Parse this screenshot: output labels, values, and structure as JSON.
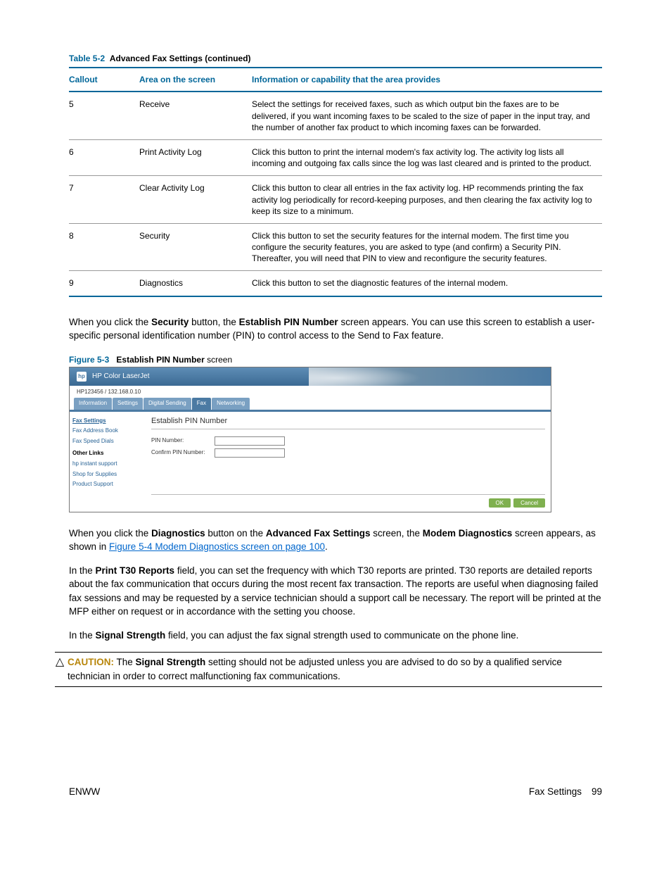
{
  "table": {
    "caption_label": "Table 5-2",
    "caption_text": "Advanced Fax Settings (continued)",
    "headers": {
      "c1": "Callout",
      "c2": "Area on the screen",
      "c3": "Information or capability that the area provides"
    },
    "rows": [
      {
        "c1": "5",
        "c2": "Receive",
        "c3": "Select the settings for received faxes, such as which output bin the faxes are to be delivered, if you want incoming faxes to be scaled to the size of paper in the input tray, and the number of another fax product to which incoming faxes can be forwarded."
      },
      {
        "c1": "6",
        "c2": "Print Activity Log",
        "c3": "Click this button to print the internal modem's fax activity log. The activity log lists all incoming and outgoing fax calls since the log was last cleared and is printed to the product."
      },
      {
        "c1": "7",
        "c2": "Clear Activity Log",
        "c3": "Click this button to clear all entries in the fax activity log. HP recommends printing the fax activity log periodically for record-keeping purposes, and then clearing the fax activity log to keep its size to a minimum."
      },
      {
        "c1": "8",
        "c2": "Security",
        "c3": "Click this button to set the security features for the internal modem. The first time you configure the security features, you are asked to type (and confirm) a Security PIN. Thereafter, you will need that PIN to view and reconfigure the security features."
      },
      {
        "c1": "9",
        "c2": "Diagnostics",
        "c3": "Click this button to set the diagnostic features of the internal modem."
      }
    ]
  },
  "para1_a": "When you click the ",
  "para1_b": "Security",
  "para1_c": " button, the ",
  "para1_d": "Establish PIN Number",
  "para1_e": " screen appears. You can use this screen to establish a user-specific personal identification number (PIN) to control access to the Send to Fax feature.",
  "figure": {
    "label": "Figure 5-3",
    "bold": "Establish PIN Number",
    "rest": " screen"
  },
  "ss": {
    "logo": "hp",
    "title": "HP Color LaserJet",
    "addr": "HP123456 / 132.168.0.10",
    "tabs": [
      "Information",
      "Settings",
      "Digital Sending",
      "Fax",
      "Networking"
    ],
    "side_links": [
      "Fax Settings",
      "Fax Address Book",
      "Fax Speed Dials"
    ],
    "other_links_hdr": "Other Links",
    "other_links": [
      "hp instant support",
      "Shop for Supplies",
      "Product Support"
    ],
    "heading": "Establish PIN Number",
    "field1": "PIN Number:",
    "field2": "Confirm PIN Number:",
    "ok": "OK",
    "cancel": "Cancel"
  },
  "para2_a": "When you click the ",
  "para2_b": "Diagnostics",
  "para2_c": " button on the ",
  "para2_d": "Advanced Fax Settings",
  "para2_e": " screen, the ",
  "para2_f": "Modem Diagnostics",
  "para2_g": " screen appears, as shown in ",
  "para2_link": "Figure 5-4 Modem Diagnostics screen on page 100",
  "para2_h": ".",
  "para3_a": "In the ",
  "para3_b": "Print T30 Reports",
  "para3_c": " field, you can set the frequency with which T30 reports are printed. T30 reports are detailed reports about the fax communication that occurs during the most recent fax transaction. The reports are useful when diagnosing failed fax sessions and may be requested by a service technician should a support call be necessary. The report will be printed at the MFP either on request or in accordance with the setting you choose.",
  "para4_a": "In the ",
  "para4_b": "Signal Strength",
  "para4_c": " field, you can adjust the fax signal strength used to communicate on the phone line.",
  "caution": {
    "label": "CAUTION:",
    "a": "   The ",
    "b": "Signal Strength",
    "c": " setting should not be adjusted unless you are advised to do so by a qualified service technician in order to correct malfunctioning fax communications."
  },
  "footer": {
    "left": "ENWW",
    "section": "Fax Settings",
    "page": "99"
  }
}
